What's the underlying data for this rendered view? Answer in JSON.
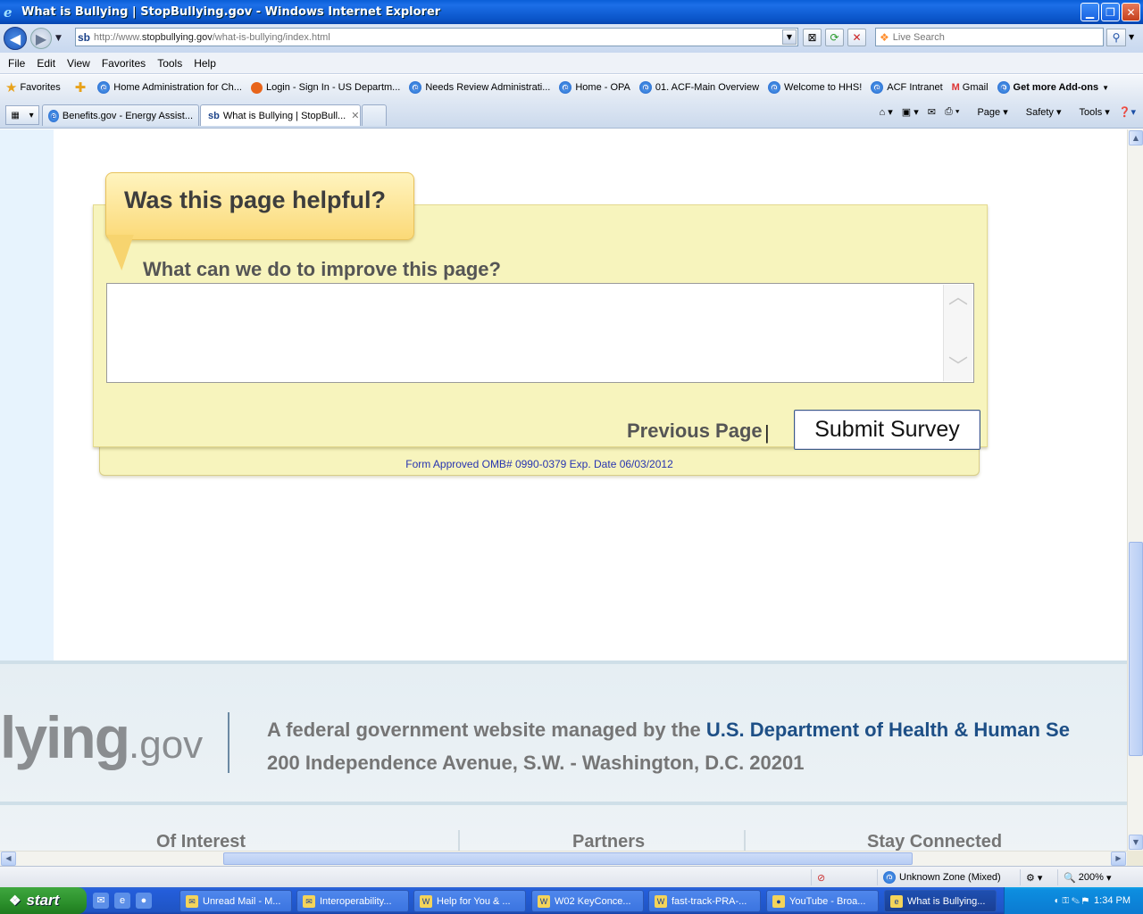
{
  "window": {
    "title": "What is Bullying | StopBullying.gov - Windows Internet Explorer"
  },
  "address_bar": {
    "url_prefix": "http://www.",
    "url_domain": "stopbullying.gov",
    "url_path": "/what-is-bullying/index.html",
    "site_icon": "sb"
  },
  "search": {
    "placeholder": "Live Search"
  },
  "menu": [
    "File",
    "Edit",
    "View",
    "Favorites",
    "Tools",
    "Help"
  ],
  "favorites_bar": {
    "label": "Favorites",
    "items": [
      "Home  Administration for Ch...",
      "Login - Sign In - US Departm...",
      "Needs Review  Administrati...",
      "Home - OPA",
      "01. ACF-Main  Overview",
      "Welcome to HHS!",
      "ACF Intranet",
      "Gmail",
      "Get more Add-ons"
    ]
  },
  "tabs": [
    {
      "label": "Benefits.gov - Energy Assist..."
    },
    {
      "label": "What is Bullying | StopBull..."
    }
  ],
  "command_bar": [
    "Page",
    "Safety",
    "Tools"
  ],
  "survey": {
    "heading": "Was this page helpful?",
    "question": "What can we do to improve this page?",
    "textarea_value": "",
    "previous_page": "Previous Page",
    "separator": "|",
    "submit_label": "Submit Survey",
    "omb_notice": "Form Approved OMB# 0990-0379 Exp. Date 06/03/2012"
  },
  "footer": {
    "logo_text": "lying",
    "logo_suffix": ".gov",
    "managed_by": "A federal government website managed by the ",
    "department": "U.S. Department of Health & Human Se",
    "address": "200 Independence Avenue, S.W. - Washington, D.C. 20201",
    "columns": [
      "Of Interest",
      "Partners",
      "Stay Connected"
    ]
  },
  "status_bar": {
    "zone": "Unknown Zone (Mixed)",
    "zoom": "200%"
  },
  "taskbar": {
    "start_label": "start",
    "tasks": [
      "Unread Mail - M...",
      "Interoperability...",
      "Help for You & ...",
      "W02 KeyConce...",
      "fast-track-PRA-...",
      "YouTube - Broa...",
      "What is Bullying..."
    ],
    "clock": "1:34 PM"
  },
  "colors": {
    "survey_bg": "#f7f4bd",
    "bubble": "#fbd977",
    "link_blue": "#2734b0",
    "hhs_blue": "#1d4f86",
    "footer_bg": "#e5eef3"
  }
}
